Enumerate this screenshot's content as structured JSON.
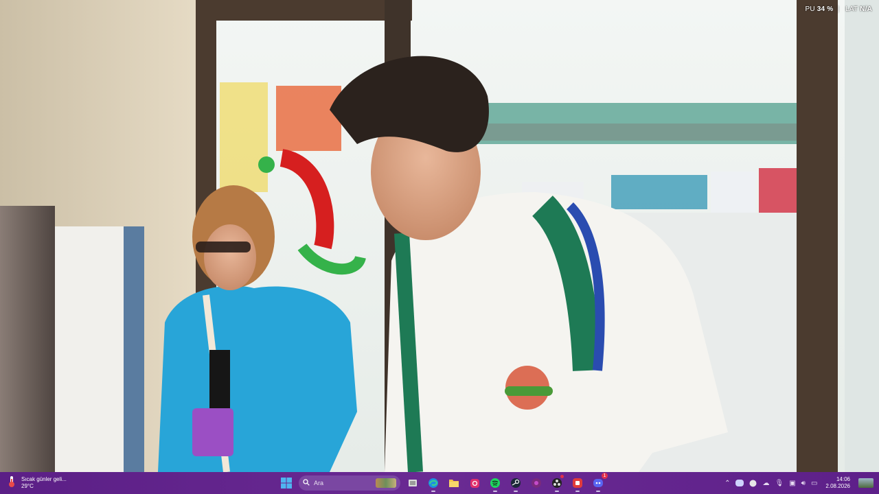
{
  "overlay": {
    "cpu_label": "PU",
    "cpu_value": "34 %",
    "lat_label": "LAT",
    "lat_value": "N/A"
  },
  "taskbar": {
    "weather": {
      "headline": "Sıcak günler geli...",
      "temperature": "29°C"
    },
    "search": {
      "placeholder": "Ara"
    },
    "apps": [
      {
        "name": "start-button",
        "icon": "windows-icon"
      },
      {
        "name": "file-explorer",
        "icon": "task-view-icon"
      },
      {
        "name": "edge",
        "icon": "edge-icon"
      },
      {
        "name": "folder",
        "icon": "folder-icon"
      },
      {
        "name": "instagram",
        "icon": "instagram-icon"
      },
      {
        "name": "spotify",
        "icon": "spotify-icon"
      },
      {
        "name": "steam",
        "icon": "steam-icon"
      },
      {
        "name": "app-pink",
        "icon": "app-icon"
      },
      {
        "name": "obs",
        "icon": "obs-icon"
      },
      {
        "name": "app-red",
        "icon": "app-icon"
      },
      {
        "name": "discord",
        "icon": "discord-icon",
        "badge": "1"
      }
    ],
    "clock": {
      "time": "14:06",
      "date": "2.08.2026"
    }
  },
  "colors": {
    "taskbar": "#5b1f86",
    "search": "#7a47a2"
  }
}
